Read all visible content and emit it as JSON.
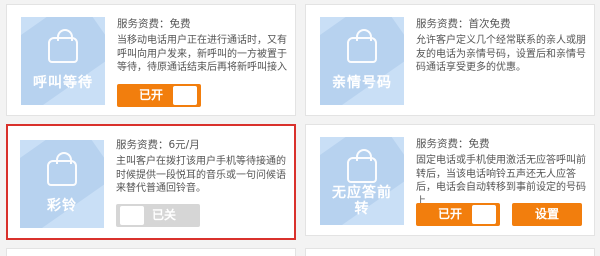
{
  "cards": {
    "hold_ring": {
      "tile_label": "呼叫等待",
      "fee": "服务资费：免费",
      "desc": "当移动电话用户正在进行通话时，又有呼叫向用户发来，新呼叫的一方被置于等待，待原通话结束后再将新呼叫接入",
      "toggle_label": "已开",
      "toggle_state": "on"
    },
    "family_numbers": {
      "tile_label": "亲情号码",
      "fee": "服务资费：首次免费",
      "desc": "允许客户定义几个经常联系的亲人或朋友的电话为亲情号码，设置后和亲情号码通话享受更多的优惠。"
    },
    "color_ring": {
      "tile_label": "彩铃",
      "fee": "服务资费：6元/月",
      "desc": "主叫客户在拨打该用户手机等待接通的时候提供一段悦耳的音乐或一句问候语来替代普通回铃音。",
      "toggle_label": "已关",
      "toggle_state": "off"
    },
    "call_forward": {
      "tile_label": "无应答前转",
      "fee": "服务资费：免费",
      "desc": "固定电话或手机使用激活无应答呼叫前转后，当该电话响铃五声还无人应答后，电话会自动转移到事前设定的号码上",
      "toggle_label": "已开",
      "toggle_state": "on",
      "settings_label": "设置"
    }
  },
  "colors": {
    "accent": "#f27e0d",
    "selected_border": "#d9312c",
    "tile_bg": "#c9dff6",
    "off_toggle": "#d6d6d6"
  },
  "icons": [
    "phone-handset-icon"
  ]
}
